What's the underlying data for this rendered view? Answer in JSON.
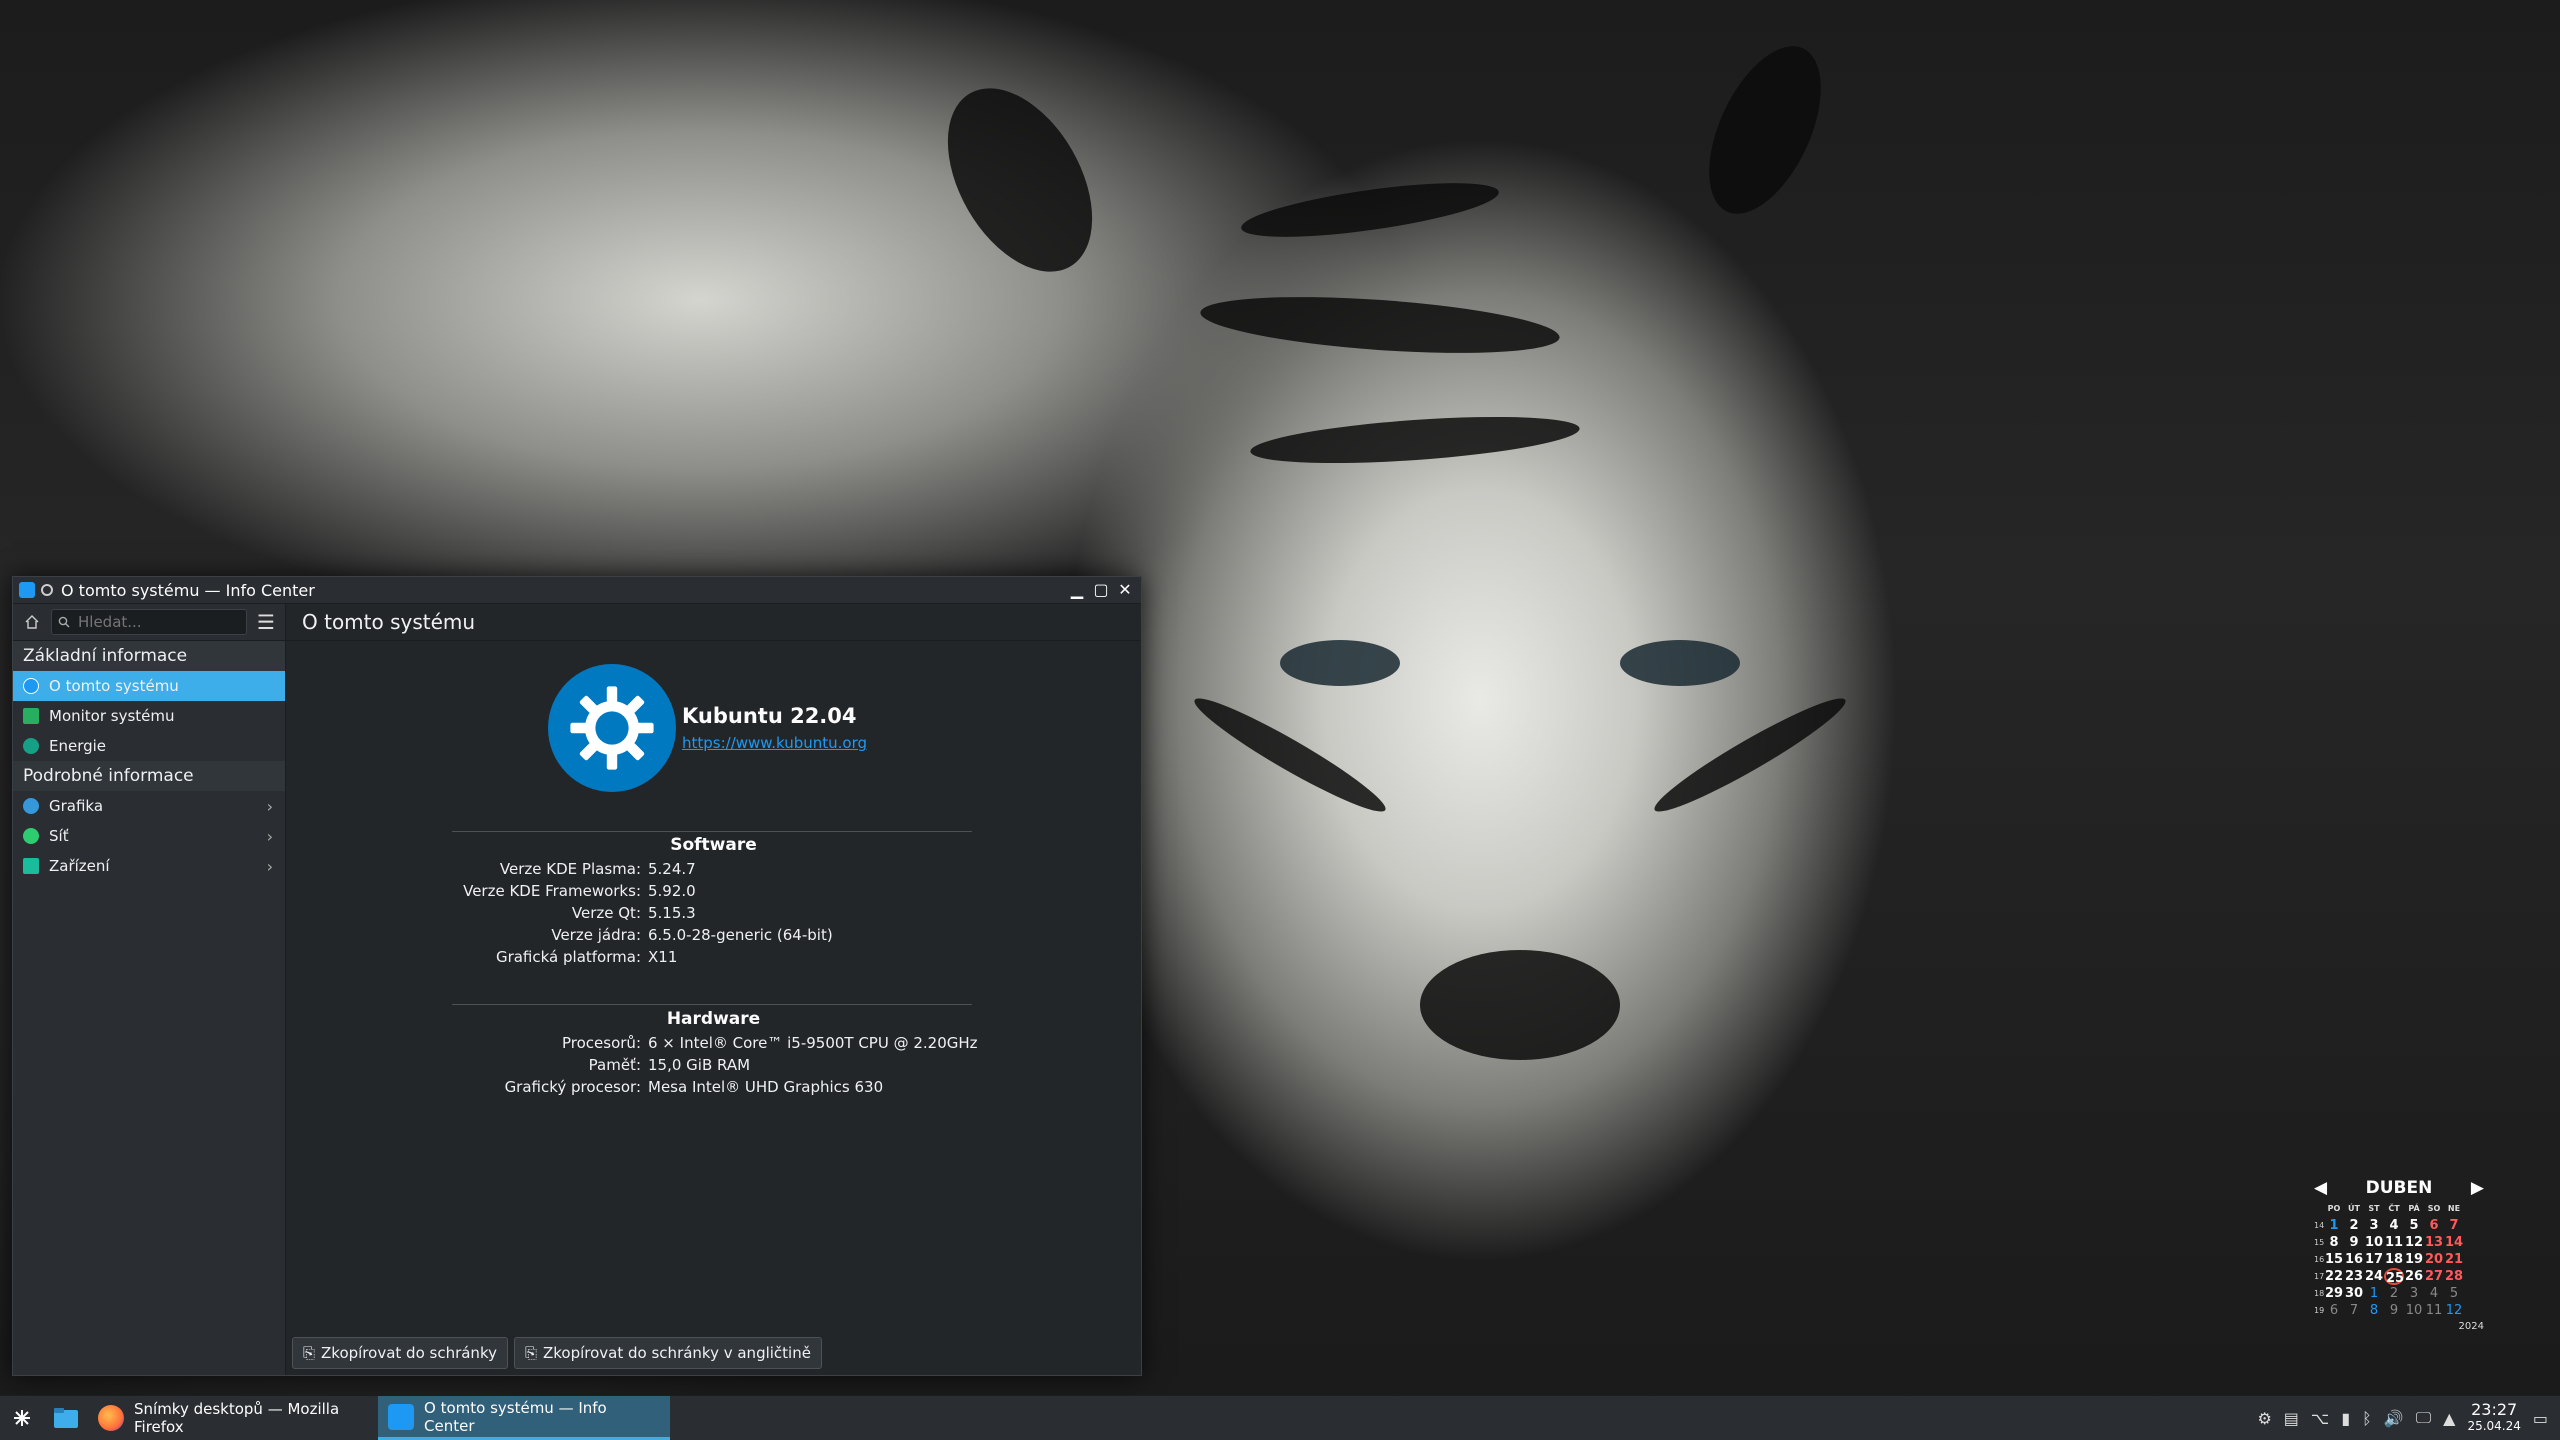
{
  "window": {
    "title": "O tomto systému — Info Center",
    "search_placeholder": "Hledat...",
    "main_title": "O tomto systému"
  },
  "sidebar": {
    "sections": [
      {
        "title": "Základní informace",
        "items": [
          {
            "label": "O tomto systému",
            "icon": "info-icon",
            "color": "#1d99f3",
            "active": true
          },
          {
            "label": "Monitor systému",
            "icon": "monitor-chart-icon",
            "color": "#27ae60"
          },
          {
            "label": "Energie",
            "icon": "energy-icon",
            "color": "#16a085"
          }
        ]
      },
      {
        "title": "Podrobné informace",
        "items": [
          {
            "label": "Grafika",
            "icon": "graphics-icon",
            "color": "#3498db",
            "chevron": true
          },
          {
            "label": "Síť",
            "icon": "network-globe-icon",
            "color": "#2ecc71",
            "chevron": true
          },
          {
            "label": "Zařízení",
            "icon": "devices-icon",
            "color": "#1abc9c",
            "chevron": true
          }
        ]
      }
    ]
  },
  "distro": {
    "name": "Kubuntu 22.04",
    "url": "https://www.kubuntu.org"
  },
  "software": {
    "title": "Software",
    "rows": [
      {
        "k": "Verze KDE Plasma:",
        "v": "5.24.7"
      },
      {
        "k": "Verze KDE Frameworks:",
        "v": "5.92.0"
      },
      {
        "k": "Verze Qt:",
        "v": "5.15.3"
      },
      {
        "k": "Verze jádra:",
        "v": "6.5.0-28-generic (64-bit)"
      },
      {
        "k": "Grafická platforma:",
        "v": "X11"
      }
    ]
  },
  "hardware": {
    "title": "Hardware",
    "rows": [
      {
        "k": "Procesorů:",
        "v": "6 × Intel® Core™ i5-9500T CPU @ 2.20GHz"
      },
      {
        "k": "Paměť:",
        "v": "15,0 GiB RAM"
      },
      {
        "k": "Grafický procesor:",
        "v": "Mesa Intel® UHD Graphics 630"
      }
    ]
  },
  "buttons": {
    "copy": "Zkopírovat do schránky",
    "copy_en": "Zkopírovat do schránky v angličtině"
  },
  "taskbar": {
    "tasks": [
      {
        "label": "Snímky desktopů — Mozilla Firefox",
        "icon": "firefox-icon",
        "color": "#ff7139"
      },
      {
        "label": "O tomto systému — Info Center",
        "icon": "info-center-icon",
        "color": "#1d99f3",
        "active": true
      }
    ],
    "time": "23:27",
    "date": "25.04.24"
  },
  "calendar": {
    "month": "DUBEN",
    "year": "2024",
    "day_headers": [
      "PO",
      "ÚT",
      "ST",
      "ČT",
      "PÁ",
      "SO",
      "NE"
    ],
    "weeks": [
      {
        "wn": "14",
        "days": [
          "1",
          "2",
          "3",
          "4",
          "5",
          "6",
          "7"
        ]
      },
      {
        "wn": "15",
        "days": [
          "8",
          "9",
          "10",
          "11",
          "12",
          "13",
          "14"
        ]
      },
      {
        "wn": "16",
        "days": [
          "15",
          "16",
          "17",
          "18",
          "19",
          "20",
          "21"
        ]
      },
      {
        "wn": "17",
        "days": [
          "22",
          "23",
          "24",
          "25",
          "26",
          "27",
          "28"
        ]
      },
      {
        "wn": "18",
        "days": [
          "29",
          "30",
          "1",
          "2",
          "3",
          "4",
          "5"
        ]
      },
      {
        "wn": "19",
        "days": [
          "6",
          "7",
          "8",
          "9",
          "10",
          "11",
          "12"
        ]
      }
    ],
    "today": "25",
    "accent": "#e74c3c"
  }
}
